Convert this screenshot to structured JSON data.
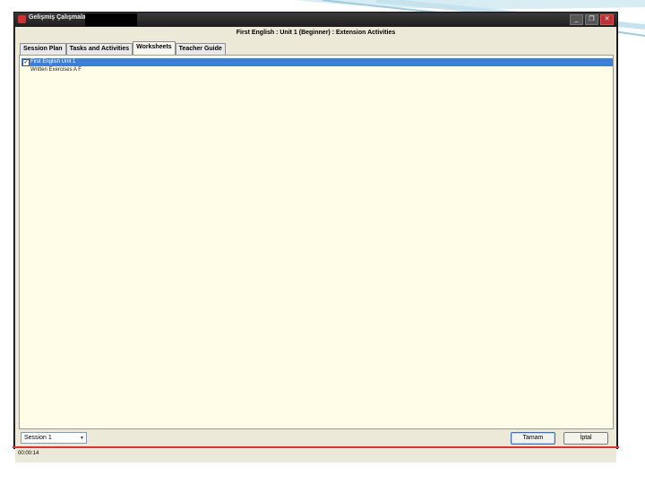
{
  "window": {
    "title": "Gelişmiş Çalışmalar...",
    "controls": [
      "_",
      "❐",
      "✕"
    ]
  },
  "header": {
    "title": "First English : Unit 1 (Beginner) : Extension Activities"
  },
  "tabs": [
    {
      "label": "Session Plan"
    },
    {
      "label": "Tasks and Activities"
    },
    {
      "label": "Worksheets"
    },
    {
      "label": "Teacher Guide"
    }
  ],
  "active_tab": "Worksheets",
  "tree": {
    "items": [
      {
        "label": "First English Unit 1",
        "checked": true
      },
      {
        "label": "Written Exercises A F"
      }
    ]
  },
  "bottom": {
    "session_value": "Session 1",
    "ok_label": "Tamam",
    "cancel_label": "İptal"
  },
  "status": {
    "text": "00:00:14"
  },
  "colors": {
    "selection": "#3b7fd6",
    "content_bg": "#fffde8",
    "accent_line": "#dd3333"
  }
}
